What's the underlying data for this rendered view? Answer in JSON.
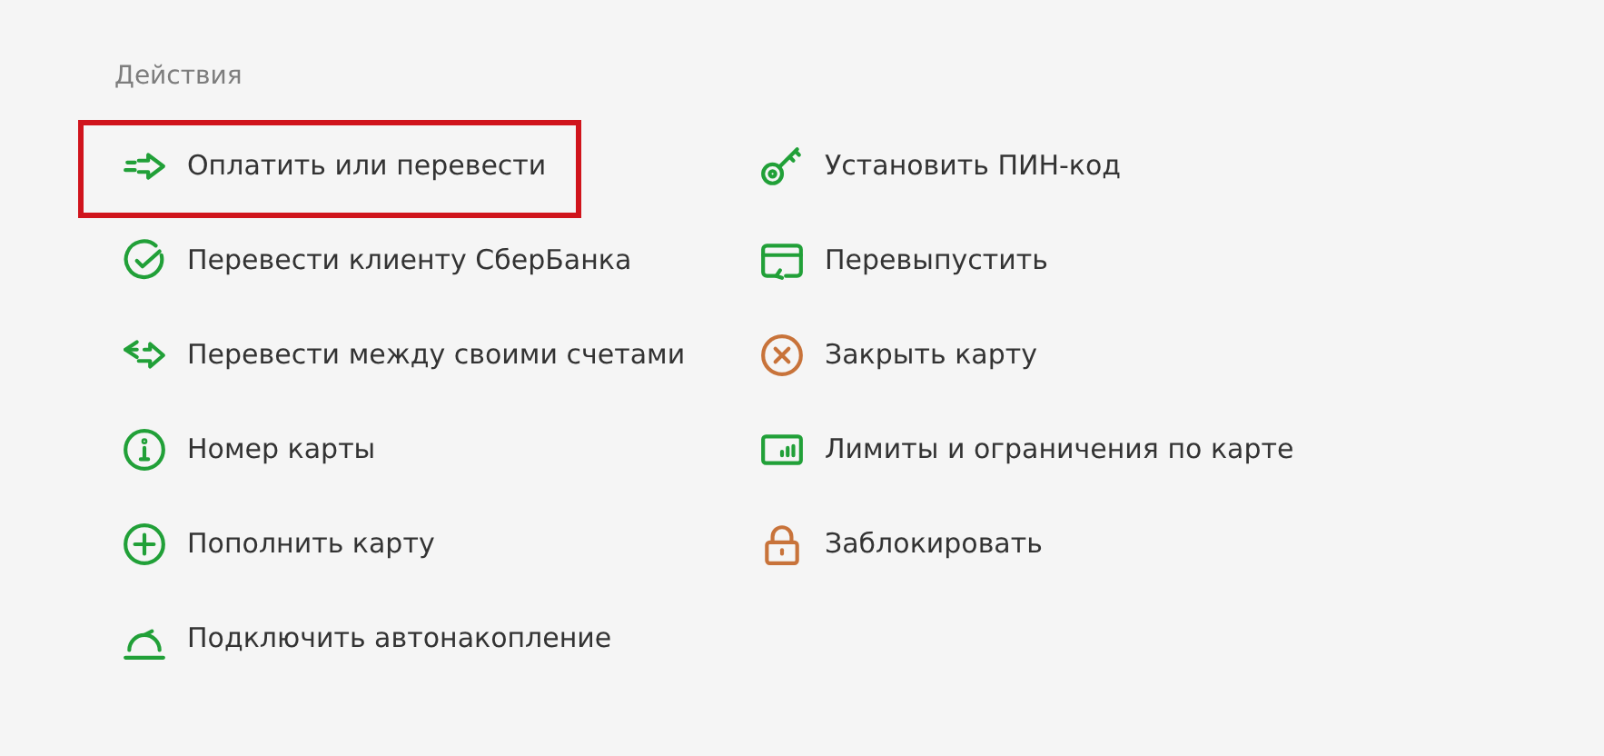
{
  "section_title": "Действия",
  "columns": [
    [
      {
        "label": "Оплатить или перевести",
        "highlighted": true,
        "color": "#21a038"
      },
      {
        "label": "Перевести клиенту СберБанка",
        "highlighted": false,
        "color": "#21a038"
      },
      {
        "label": "Перевести между своими счетами",
        "highlighted": false,
        "color": "#21a038"
      },
      {
        "label": "Номер карты",
        "highlighted": false,
        "color": "#21a038"
      },
      {
        "label": "Пополнить карту",
        "highlighted": false,
        "color": "#21a038"
      },
      {
        "label": "Подключить автонакопление",
        "highlighted": false,
        "color": "#21a038"
      }
    ],
    [
      {
        "label": "Установить ПИН-код",
        "highlighted": false,
        "color": "#21a038"
      },
      {
        "label": "Перевыпустить",
        "highlighted": false,
        "color": "#21a038"
      },
      {
        "label": "Закрыть карту",
        "highlighted": false,
        "color": "#c8733a"
      },
      {
        "label": "Лимиты и ограничения по карте",
        "highlighted": false,
        "color": "#21a038"
      },
      {
        "label": "Заблокировать",
        "highlighted": false,
        "color": "#c8733a"
      }
    ]
  ]
}
